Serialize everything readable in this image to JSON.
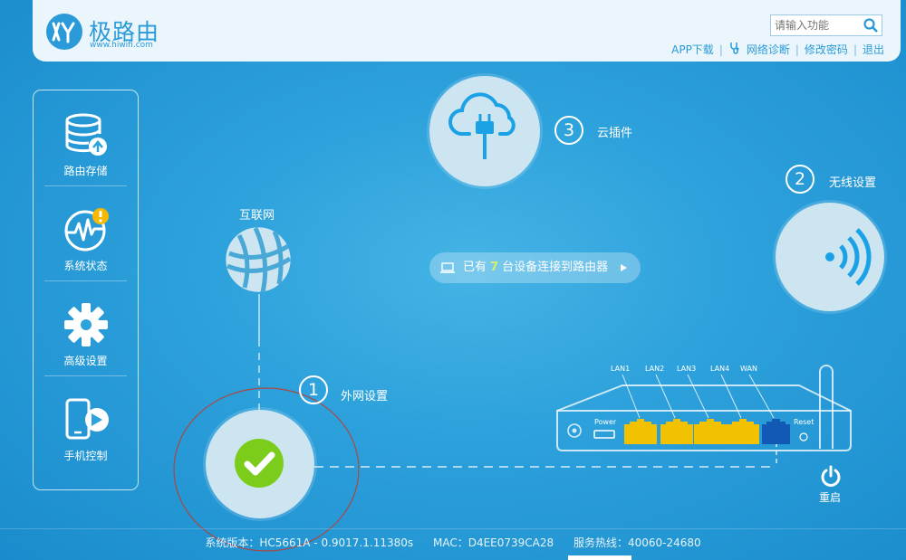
{
  "header": {
    "logo_title": "极路由",
    "logo_url": "www.hiwifi.com",
    "search_placeholder": "请输入功能",
    "links": {
      "app_download": "APP下载",
      "network_diagnosis": "网络诊断",
      "change_password": "修改密码",
      "logout": "退出"
    }
  },
  "sidebar": {
    "items": [
      {
        "label": "路由存储",
        "icon": "storage-icon"
      },
      {
        "label": "系统状态",
        "icon": "system-status-icon"
      },
      {
        "label": "高级设置",
        "icon": "gear-icon"
      },
      {
        "label": "手机控制",
        "icon": "phone-control-icon"
      }
    ]
  },
  "main": {
    "internet_label": "互联网",
    "wan": {
      "number": "1",
      "label": "外网设置"
    },
    "wireless": {
      "number": "2",
      "label": "无线设置"
    },
    "cloud": {
      "number": "3",
      "label": "云插件"
    },
    "devices": {
      "prefix": "已有",
      "count": "7",
      "suffix": "台设备连接到路由器"
    },
    "router": {
      "ports": [
        "LAN1",
        "LAN2",
        "LAN3",
        "LAN4",
        "WAN"
      ],
      "power_label": "Power",
      "reset_label": "Reset"
    },
    "restart_label": "重启"
  },
  "footer": {
    "version": "系统版本：HC5661A - 0.9017.1.11380s",
    "mac": "MAC：D4EE0739CA28",
    "hotline": "服务热线：40060-24680"
  },
  "colors": {
    "background": "#2ea2dc",
    "accent": "#2a9ad8",
    "lan_port": "#f2c200",
    "wan_port": "#1259b6",
    "check_green": "#7ccd1b"
  }
}
